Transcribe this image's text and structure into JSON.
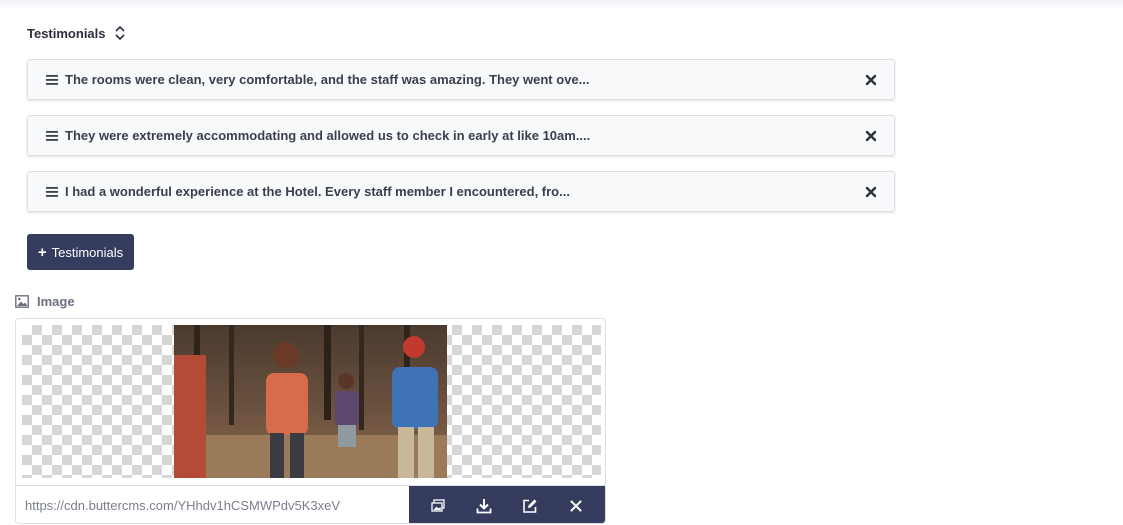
{
  "section": {
    "title": "Testimonials",
    "sort_icon": "sort-up-down-icon"
  },
  "testimonials": [
    {
      "text": "The rooms were clean, very comfortable, and the staff was amazing. They went ove..."
    },
    {
      "text": "They were extremely accommodating and allowed us to check in early at like 10am...."
    },
    {
      "text": "I had a wonderful experience at the Hotel. Every staff member I encountered, fro..."
    }
  ],
  "add_button": {
    "plus": "+",
    "label": "Testimonials"
  },
  "image_field": {
    "label": "Image",
    "url": "https://cdn.buttercms.com/YHhdv1hCSMWPdv5K3xeV",
    "tools": [
      "gallery-icon",
      "download-icon",
      "edit-icon",
      "close-icon"
    ]
  },
  "colors": {
    "primary": "#353c5e",
    "text": "#2b2f3d",
    "border": "#dcdfe6"
  }
}
